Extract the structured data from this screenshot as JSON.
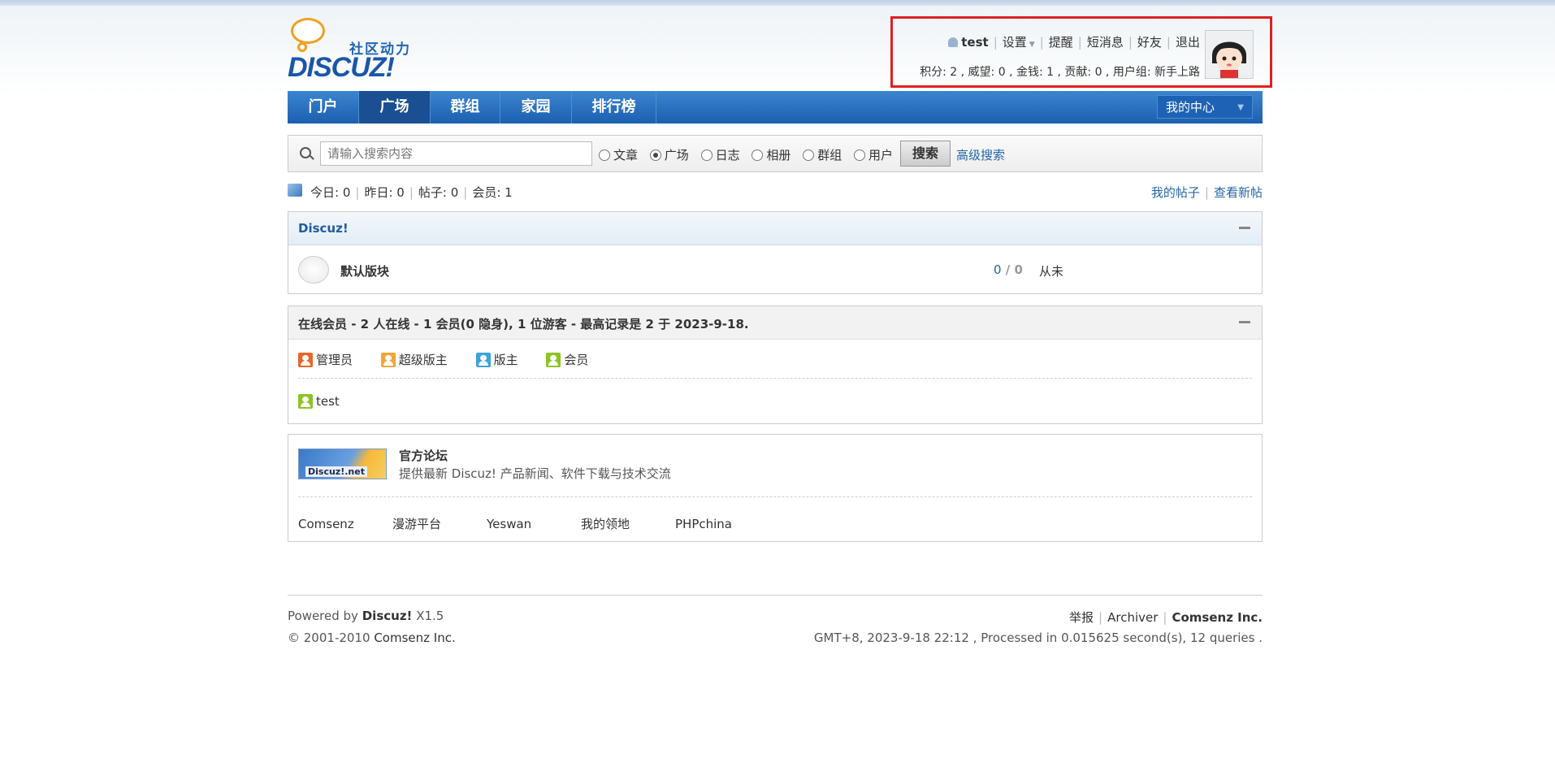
{
  "logo": {
    "tagline": "社区动力",
    "brand": "DISCUZ!"
  },
  "user": {
    "name": "test",
    "links": [
      "设置",
      "提醒",
      "短消息",
      "好友",
      "退出"
    ],
    "stats": "积分: 2 , 威望: 0 , 金钱: 1 , 贡献: 0 , 用户组: 新手上路"
  },
  "nav": {
    "items": [
      "门户",
      "广场",
      "群组",
      "家园",
      "排行榜"
    ],
    "active": "广场",
    "my_center": "我的中心"
  },
  "search": {
    "placeholder": "请输入搜索内容",
    "options": [
      "文章",
      "广场",
      "日志",
      "相册",
      "群组",
      "用户"
    ],
    "selected": "广场",
    "button": "搜索",
    "advanced": "高级搜索"
  },
  "stats": {
    "today": "今日: 0",
    "yesterday": "昨日: 0",
    "posts": "帖子: 0",
    "members": "会员: 1",
    "my_posts": "我的帖子",
    "new_posts": "查看新帖"
  },
  "forum": {
    "category": "Discuz!",
    "board": "默认版块",
    "threads": "0",
    "posts": "0",
    "last": "从未"
  },
  "online": {
    "title": "在线会员 - 2 人在线 - 1 会员(0 隐身), 1 位游客 - 最高记录是 2 于 2023-9-18.",
    "legend": [
      "管理员",
      "超级版主",
      "版主",
      "会员"
    ],
    "users": [
      "test"
    ]
  },
  "links": {
    "logo_text": "Discuz!.net",
    "official_name": "官方论坛",
    "official_desc": "提供最新 Discuz! 产品新闻、软件下载与技术交流",
    "others": [
      "Comsenz",
      "漫游平台",
      "Yeswan",
      "我的领地",
      "PHPchina"
    ]
  },
  "footer": {
    "powered_prefix": "Powered by",
    "powered_name": "Discuz!",
    "version": "X1.5",
    "copyright_prefix": "© 2001-2010",
    "copyright_company": "Comsenz Inc.",
    "report": "举报",
    "archiver": "Archiver",
    "company": "Comsenz Inc.",
    "timing": "GMT+8, 2023-9-18 22:12 , Processed in 0.015625 second(s), 12 queries ."
  }
}
